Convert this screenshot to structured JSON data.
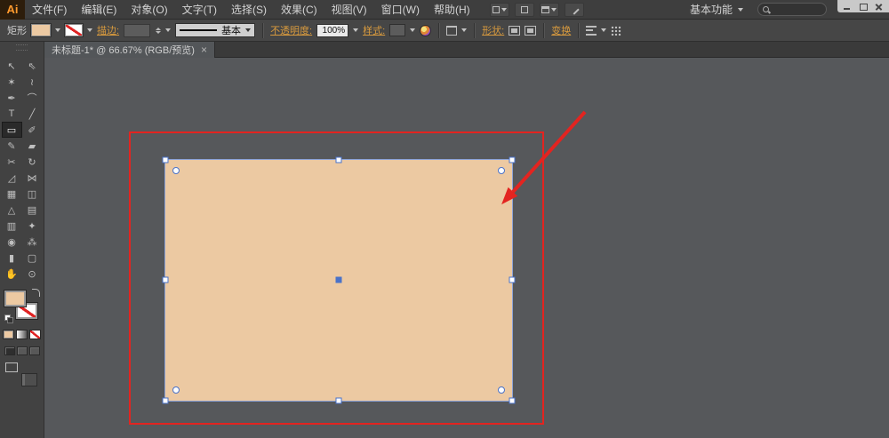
{
  "app": {
    "logo_text": "Ai"
  },
  "menubar": {
    "items": [
      {
        "label": "文件(F)"
      },
      {
        "label": "编辑(E)"
      },
      {
        "label": "对象(O)"
      },
      {
        "label": "文字(T)"
      },
      {
        "label": "选择(S)"
      },
      {
        "label": "效果(C)"
      },
      {
        "label": "视图(V)"
      },
      {
        "label": "窗口(W)"
      },
      {
        "label": "帮助(H)"
      }
    ],
    "workspace_label": "基本功能"
  },
  "controlbar": {
    "selection_label": "矩形",
    "stroke_label": "描边:",
    "stroke_value": "",
    "stroke_profile_label": "基本",
    "opacity_label": "不透明度:",
    "opacity_value": "100%",
    "style_label": "样式:",
    "shape_label": "形状:",
    "transform_label": "变换"
  },
  "tabbar": {
    "active_tab_title": "未标题-1* @ 66.67% (RGB/预览)",
    "close_glyph": "×"
  },
  "toolbar": {
    "tools": [
      {
        "name": "selection-tool",
        "glyph": "↖"
      },
      {
        "name": "direct-selection-tool",
        "glyph": "⇖"
      },
      {
        "name": "magic-wand-tool",
        "glyph": "✶"
      },
      {
        "name": "lasso-tool",
        "glyph": "≀"
      },
      {
        "name": "pen-tool",
        "glyph": "✒"
      },
      {
        "name": "curvature-tool",
        "glyph": "⌒"
      },
      {
        "name": "type-tool",
        "glyph": "T"
      },
      {
        "name": "line-segment-tool",
        "glyph": "╱"
      },
      {
        "name": "rectangle-tool",
        "glyph": "▭",
        "selected": true
      },
      {
        "name": "paintbrush-tool",
        "glyph": "✐"
      },
      {
        "name": "pencil-tool",
        "glyph": "✎"
      },
      {
        "name": "eraser-tool",
        "glyph": "▰"
      },
      {
        "name": "scissors-tool",
        "glyph": "✂"
      },
      {
        "name": "rotate-tool",
        "glyph": "↻"
      },
      {
        "name": "scale-tool",
        "glyph": "◿"
      },
      {
        "name": "width-tool",
        "glyph": "⋈"
      },
      {
        "name": "free-transform-tool",
        "glyph": "▦"
      },
      {
        "name": "shape-builder-tool",
        "glyph": "◫"
      },
      {
        "name": "perspective-grid-tool",
        "glyph": "△"
      },
      {
        "name": "mesh-tool",
        "glyph": "▤"
      },
      {
        "name": "gradient-tool",
        "glyph": "▥"
      },
      {
        "name": "eyedropper-tool",
        "glyph": "✦"
      },
      {
        "name": "blend-tool",
        "glyph": "◉"
      },
      {
        "name": "symbol-sprayer-tool",
        "glyph": "⁂"
      },
      {
        "name": "column-graph-tool",
        "glyph": "▮"
      },
      {
        "name": "artboard-tool",
        "glyph": "▢"
      },
      {
        "name": "hand-tool",
        "glyph": "✋"
      },
      {
        "name": "zoom-tool",
        "glyph": "⊙"
      }
    ]
  },
  "colors": {
    "canvas_bg": "#56585b",
    "shape_fill": "#ecc9a2",
    "annotation_red": "#e32420",
    "selection_blue": "#4a72c8",
    "accent_amber": "#d89a3e"
  }
}
